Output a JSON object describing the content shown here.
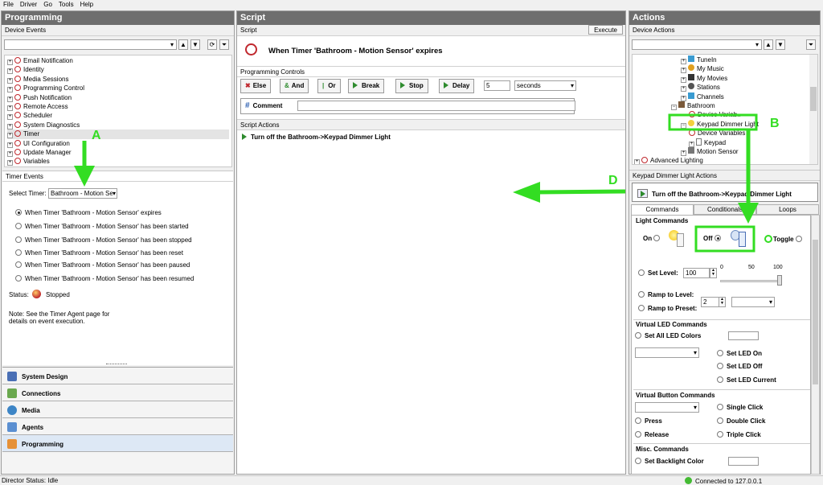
{
  "menu": [
    "File",
    "Driver",
    "Go",
    "Tools",
    "Help"
  ],
  "programming": {
    "title": "Programming",
    "device_events_label": "Device Events",
    "events": [
      "Email Notification",
      "Identity",
      "Media Sessions",
      "Programming Control",
      "Push Notification",
      "Remote Access",
      "Scheduler",
      "System Diagnostics",
      "Timer",
      "UI Configuration",
      "Update Manager",
      "Variables"
    ],
    "timer_events_label": "Timer Events",
    "select_timer_label": "Select Timer:",
    "select_timer_value": "Bathroom - Motion Se",
    "timer_options": [
      "When Timer 'Bathroom - Motion Sensor' expires",
      "When Timer 'Bathroom - Motion Sensor' has been started",
      "When Timer 'Bathroom - Motion Sensor' has been stopped",
      "When Timer 'Bathroom - Motion Sensor' has been reset",
      "When Timer 'Bathroom - Motion Sensor' has been paused",
      "When Timer 'Bathroom - Motion Sensor' has been resumed"
    ],
    "status_label": "Status:",
    "status_value": "Stopped",
    "note_line1": "Note: See the Timer Agent page for",
    "note_line2": "details on event execution.",
    "nav": [
      "System Design",
      "Connections",
      "Media",
      "Agents",
      "Programming"
    ]
  },
  "script": {
    "title": "Script",
    "sub_label": "Script",
    "execute_label": "Execute",
    "event_title": "When Timer 'Bathroom - Motion Sensor' expires",
    "controls_label": "Programming Controls",
    "buttons": {
      "else": "Else",
      "and": "And",
      "or": "Or",
      "break": "Break",
      "stop": "Stop",
      "delay": "Delay"
    },
    "delay_value": "5",
    "delay_unit": "seconds",
    "comment_label": "Comment",
    "actions_label": "Script Actions",
    "action_line": "Turn off the Bathroom->Keypad Dimmer Light"
  },
  "actions": {
    "title": "Actions",
    "device_actions_label": "Device Actions",
    "tree": [
      "TuneIn",
      "My Music",
      "My Movies",
      "Stations",
      "Channels",
      "Bathroom",
      "Device Variab..",
      "Keypad Dimmer Light",
      "Device Variables",
      "Keypad",
      "Motion Sensor",
      "Advanced Lighting"
    ],
    "kd_actions_label": "Keypad Dimmer Light Actions",
    "kd_action_line": "Turn off the Bathroom->Keypad Dimmer Light",
    "tabs": [
      "Commands",
      "Conditionals",
      "Loops"
    ],
    "light_commands": "Light Commands",
    "on": "On",
    "off": "Off",
    "toggle": "Toggle",
    "set_level": "Set Level:",
    "level_value": "100",
    "scale": [
      "0",
      "50",
      "100"
    ],
    "ramp_level": "Ramp to Level:",
    "ramp_preset": "Ramp to Preset:",
    "preset_value": "2",
    "vled_header": "Virtual LED Commands",
    "set_all_led": "Set All LED Colors",
    "led_on": "Set LED On",
    "led_off": "Set LED Off",
    "led_current": "Set LED Current",
    "vbtn_header": "Virtual Button Commands",
    "press": "Press",
    "release": "Release",
    "single": "Single Click",
    "double": "Double Click",
    "triple": "Triple Click",
    "misc_header": "Misc. Commands",
    "backlight": "Set Backlight Color"
  },
  "annotations": {
    "a": "A",
    "b": "B",
    "d": "D"
  },
  "statusbar": {
    "left": "Director Status: Idle",
    "right": "Connected to 127.0.0.1"
  },
  "colors": {
    "accent_green": "#33dd22",
    "header_gray": "#6e6e6e",
    "control4_red": "#c0282e"
  }
}
